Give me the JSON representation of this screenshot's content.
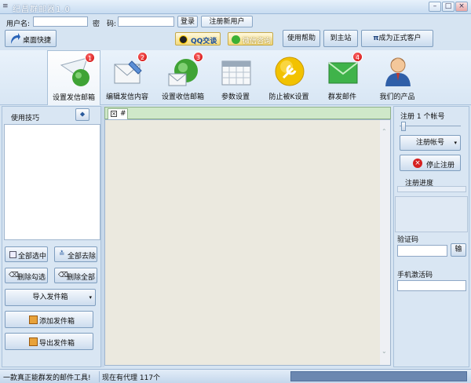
{
  "window": {
    "title": "纪昌群邮器1.0",
    "minimize": "–",
    "maximize": "□",
    "close": "×"
  },
  "login": {
    "username_label": "用户名:",
    "username_value": "",
    "password_label": "密　码:",
    "password_value": "",
    "login_button": "登录",
    "register_button": "注册新用户"
  },
  "toolbar": {
    "desktop_shortcut": "桌面快捷",
    "qq_chat": "QQ交谈",
    "wechat_consult": "微信咨询",
    "help": "使用帮助",
    "home": "到主站",
    "become_customer": "成为正式客户",
    "customer_prefix": "π"
  },
  "nav": [
    {
      "label": "设置发信邮箱",
      "icon": "send-mailbox-icon",
      "badge": "1"
    },
    {
      "label": "编辑发信内容",
      "icon": "edit-content-icon",
      "badge": "2"
    },
    {
      "label": "设置收信邮箱",
      "icon": "receive-mailbox-icon",
      "badge": "3"
    },
    {
      "label": "参数设置",
      "icon": "calendar-settings-icon",
      "badge": ""
    },
    {
      "label": "防止被K设置",
      "icon": "wrench-icon",
      "badge": ""
    },
    {
      "label": "群发邮件",
      "icon": "envelope-icon",
      "badge": "4"
    },
    {
      "label": "我们的产品",
      "icon": "user-product-icon",
      "badge": ""
    }
  ],
  "left_panel": {
    "tips_label": "使用技巧",
    "select_all": "全部选中",
    "remove_all": "全部去除",
    "delete_checked": "删除勾选",
    "delete_all": "删除全部",
    "import_senders": "导入发件箱",
    "add_sender": "添加发件箱",
    "export_senders": "导出发件箱"
  },
  "center": {
    "tab_label": "#"
  },
  "right_panel": {
    "register_count_label": "注册 1 个帐号",
    "register_account_button": "注册帐号",
    "stop_register_button": "停止注册",
    "progress_label": "注册进度",
    "progress": 0,
    "captcha_label": "验证码",
    "captcha_button": "输",
    "phone_code_label": "手机激活码"
  },
  "status": {
    "left": "一款真正能群发的邮件工具!",
    "proxy": "现在有代理 117个"
  },
  "colors": {
    "accent": "#3a6ea5",
    "badge": "#d10000"
  }
}
